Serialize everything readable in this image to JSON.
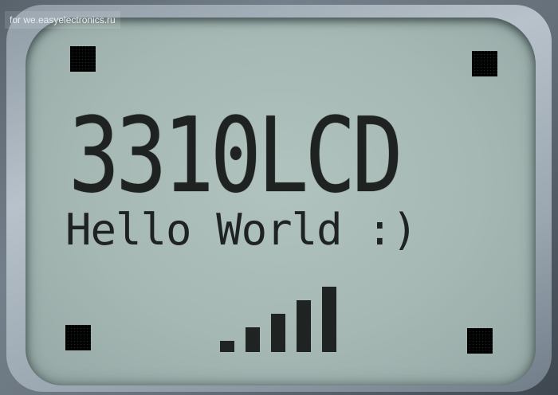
{
  "watermark": "for we.easyelectronics.ru",
  "display": {
    "line1": "3310LCD",
    "line2": "Hello World :)"
  },
  "signal": {
    "level": 5,
    "max": 5
  },
  "colors": {
    "lcd_background": "#a9bbb7",
    "pixel": "#1e2221",
    "bezel": "#8f9ba5"
  }
}
